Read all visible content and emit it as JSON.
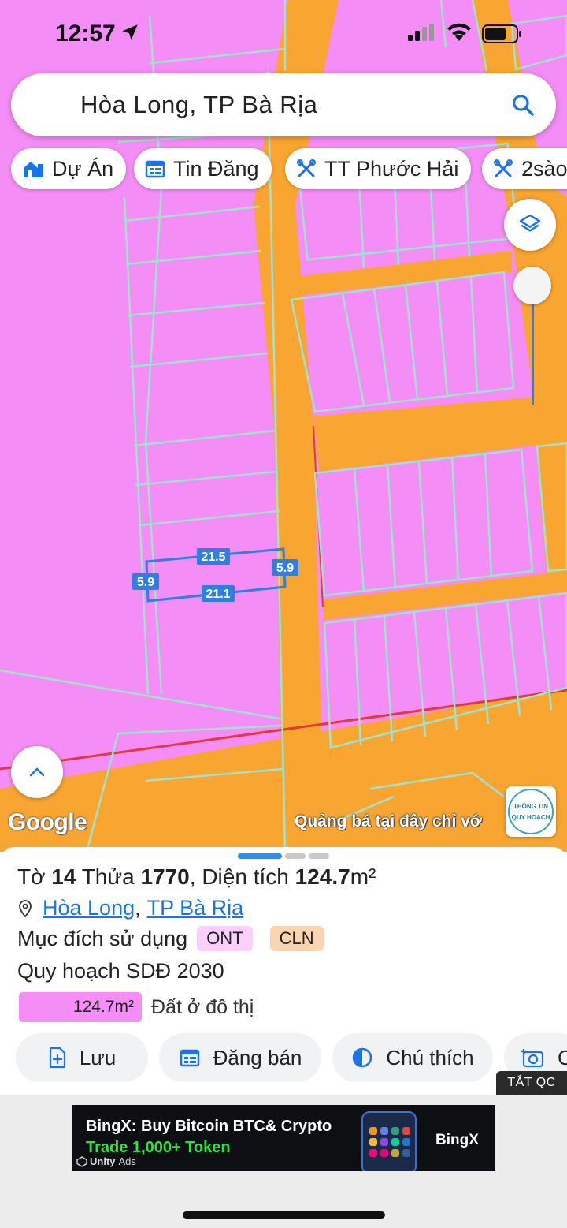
{
  "status_bar": {
    "time": "12:57"
  },
  "search": {
    "query": "Hòa Long, TP Bà Rịa"
  },
  "chips": [
    {
      "label": "Dự Án",
      "icon": "house-icon"
    },
    {
      "label": "Tin Đăng",
      "icon": "calendar-icon"
    },
    {
      "label": "TT Phước Hải",
      "icon": "crossed-tools-icon"
    },
    {
      "label": "2sào",
      "icon": "crossed-tools-icon"
    }
  ],
  "map": {
    "colors": {
      "residential": "#f48df5",
      "road": "#f9a531",
      "lot_line": "#9fe2cd",
      "measure": "#2f7fe0"
    },
    "measurements": {
      "top": "21.5",
      "bottom": "21.1",
      "left": "5.9",
      "right": "5.9"
    },
    "attribution": "Google",
    "ad_text": "Quảng bá tại đây chỉ vớ",
    "info_logo": {
      "line1": "THÔNG TIN",
      "line2": "QUY HOẠCH"
    }
  },
  "parcel": {
    "prefix_to": "Tờ",
    "to": "14",
    "prefix_thua": "Thửa",
    "thua": "1770",
    "prefix_area": ", Diện tích",
    "area": "124.7",
    "area_unit": "m²",
    "location_commune": "Hòa Long",
    "location_separator": ",",
    "location_city": "TP Bà Rịa",
    "purpose_label": "Mục đích sử dụng",
    "purpose_tags": [
      {
        "code": "ONT",
        "bg": "#fbd0fb"
      },
      {
        "code": "CLN",
        "bg": "#fbd4b0"
      }
    ],
    "plan_label": "Quy hoạch SDĐ 2030",
    "plan_area": "124.7m²",
    "plan_type": "Đất ở đô thị",
    "plan_color": "#f48df5"
  },
  "actions": [
    {
      "label": "Lưu",
      "icon": "save-doc-icon"
    },
    {
      "label": "Đăng bán",
      "icon": "calendar-icon"
    },
    {
      "label": "Chú thích",
      "icon": "contrast-icon"
    },
    {
      "label": "C",
      "icon": "camera-icon"
    }
  ],
  "ad_toggle": "TẮT QC",
  "banner": {
    "line1": "BingX: Buy Bitcoin BTC& Crypto",
    "line2": "Trade 1,000+ Token",
    "brand": "BingX",
    "unity": "Unity",
    "ads": "Ads"
  }
}
